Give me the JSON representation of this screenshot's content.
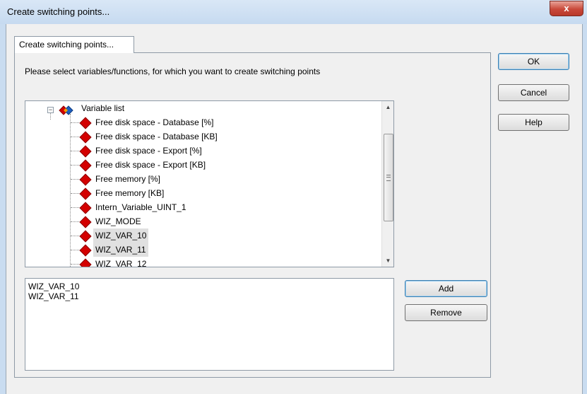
{
  "window": {
    "title": "Create switching points...",
    "close_glyph": "x"
  },
  "tab": {
    "label": "Create switching points..."
  },
  "instruction": "Please select variables/functions, for which you want to create switching points",
  "tree": {
    "root_label": "Variable list",
    "root_expander": "−",
    "items": [
      {
        "label": "Free disk space - Database [%]",
        "selected": false
      },
      {
        "label": "Free disk space - Database [KB]",
        "selected": false
      },
      {
        "label": "Free disk space - Export [%]",
        "selected": false
      },
      {
        "label": "Free disk space - Export [KB]",
        "selected": false
      },
      {
        "label": "Free memory [%]",
        "selected": false
      },
      {
        "label": "Free memory [KB]",
        "selected": false
      },
      {
        "label": "Intern_Variable_UINT_1",
        "selected": false
      },
      {
        "label": "WIZ_MODE",
        "selected": false
      },
      {
        "label": "WIZ_VAR_10",
        "selected": true
      },
      {
        "label": "WIZ_VAR_11",
        "selected": true
      },
      {
        "label": "WIZ_VAR_12",
        "selected": false
      }
    ],
    "scroll_up_glyph": "▲",
    "scroll_down_glyph": "▼"
  },
  "selected_list": [
    "WIZ_VAR_10",
    "WIZ_VAR_11"
  ],
  "buttons": {
    "add": "Add",
    "remove": "Remove",
    "ok": "OK",
    "cancel": "Cancel",
    "help": "Help"
  },
  "colors": {
    "item_icon": "#d40000",
    "selection": "#e0e0e0",
    "titlebar": "#c9dcf0",
    "close_button": "#c9493a"
  }
}
